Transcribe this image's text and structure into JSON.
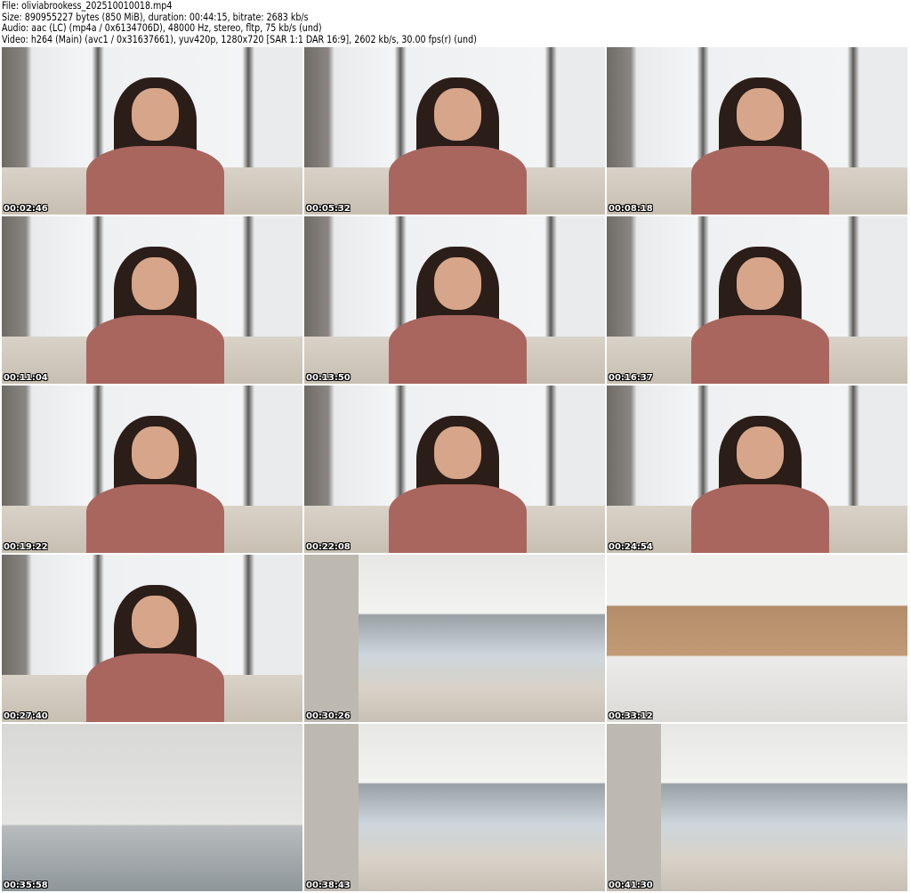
{
  "header": {
    "file_line": "File: oliviabrookess_202510010018.mp4",
    "size_line": "Size: 890955227 bytes (850 MiB), duration: 00:44:15, bitrate: 2683 kb/s",
    "audio_line": "Audio: aac (LC) (mp4a / 0x6134706D), 48000 Hz, stereo, fltp, 75 kb/s (und)",
    "video_line": "Video: h264 (Main) (avc1 / 0x31637661), yuv420p, 1280x720 [SAR 1:1 DAR 16:9], 2602 kb/s, 30.00 fps(r) (und)"
  },
  "thumbnails": [
    {
      "timestamp": "00:02:46",
      "scene": "indoor-portrait"
    },
    {
      "timestamp": "00:05:32",
      "scene": "indoor-portrait"
    },
    {
      "timestamp": "00:08:18",
      "scene": "indoor-portrait"
    },
    {
      "timestamp": "00:11:04",
      "scene": "indoor-portrait"
    },
    {
      "timestamp": "00:13:50",
      "scene": "indoor-portrait"
    },
    {
      "timestamp": "00:16:37",
      "scene": "indoor-portrait"
    },
    {
      "timestamp": "00:19:22",
      "scene": "indoor-portrait"
    },
    {
      "timestamp": "00:22:08",
      "scene": "indoor-portrait"
    },
    {
      "timestamp": "00:24:54",
      "scene": "indoor-portrait"
    },
    {
      "timestamp": "00:27:40",
      "scene": "indoor-portrait"
    },
    {
      "timestamp": "00:30:26",
      "scene": "room"
    },
    {
      "timestamp": "00:33:12",
      "scene": "kitchen"
    },
    {
      "timestamp": "00:35:58",
      "scene": "ceiling"
    },
    {
      "timestamp": "00:38:43",
      "scene": "room"
    },
    {
      "timestamp": "00:41:30",
      "scene": "room"
    }
  ]
}
